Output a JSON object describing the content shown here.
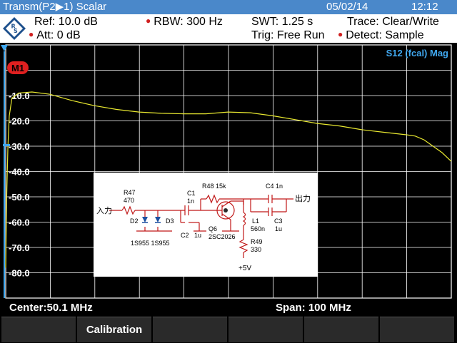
{
  "title_bar": {
    "mode": "Transm(P2▶1) Scalar",
    "date": "05/02/14",
    "time": "12:12"
  },
  "settings": {
    "ref": "Ref:  10.0 dB",
    "att": "Att:  0 dB",
    "rbw": "RBW:   300 Hz",
    "swt": "SWT:   1.25 s",
    "trig": "Trig:   Free Run",
    "trace": "Trace:   Clear/Write",
    "detect": "Detect:  Sample"
  },
  "trace_label": "S12 (fcal) Mag",
  "marker_label": "M1",
  "colors": {
    "title_bg": "#4a88ca",
    "trace": "#e8e830",
    "grid": "#ffffff",
    "marker": "#e02020",
    "trace_label": "#40a8f0"
  },
  "chart_data": {
    "type": "line",
    "xlabel": "",
    "ylabel": "",
    "ylim": [
      -90,
      10
    ],
    "y_ticks": [
      "-10.0",
      "-20.0",
      "-30.0",
      "-40.0",
      "-50.0",
      "-60.0",
      "-70.0",
      "-80.0"
    ],
    "x_range_mhz": [
      0.1,
      100.1
    ],
    "series": [
      {
        "x": [
          0.1,
          0.3,
          0.6,
          0.9,
          1.5,
          3,
          6,
          10,
          15,
          20,
          25,
          30,
          35,
          40,
          45,
          50,
          55,
          60,
          65,
          70,
          75,
          80,
          85,
          90,
          92,
          94,
          96,
          98,
          100.1
        ],
        "values": [
          -78,
          -52,
          -30,
          -18,
          -11,
          -9,
          -8.6,
          -9.5,
          -12,
          -14,
          -15.5,
          -16.5,
          -17,
          -17.2,
          -17.2,
          -16.5,
          -16.8,
          -18,
          -19.5,
          -21,
          -22,
          -23.5,
          -24.5,
          -25.5,
          -26,
          -27.5,
          -30,
          -32.5,
          -36
        ]
      }
    ]
  },
  "footer": {
    "center": "Center:50.1 MHz",
    "span": "Span:      100 MHz"
  },
  "softkeys": [
    "",
    "Calibration",
    "",
    "",
    "",
    ""
  ],
  "schematic": {
    "input_label": "入力",
    "output_label": "出力",
    "r47": "R47",
    "r47_val": "470",
    "c1": "C1",
    "c1_val": "1n",
    "r48": "R48 15k",
    "c4": "C4   1n",
    "d2": "D2",
    "d3": "D3",
    "diode_part": "1S955  1S955",
    "c2": "C2",
    "c2_val": "1u",
    "q6": "Q6",
    "q6_part": "2SC2026",
    "l1": "L1",
    "l1_val": "560n",
    "c3": "C3",
    "c3_val": "1u",
    "r49": "R49",
    "r49_val": "330",
    "supply": "+5V"
  }
}
